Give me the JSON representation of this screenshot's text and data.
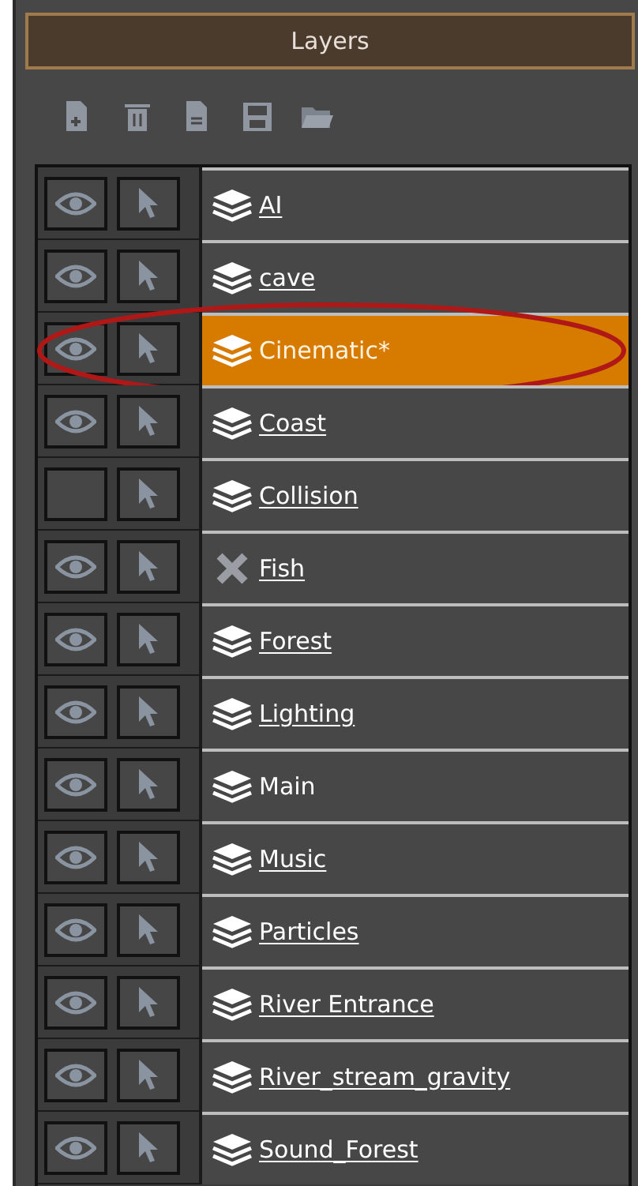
{
  "panel": {
    "title": "Layers"
  },
  "layers": [
    {
      "name": "AI",
      "kind": "layer",
      "visible": true,
      "underlined": true,
      "selected": false
    },
    {
      "name": "cave",
      "kind": "layer",
      "visible": true,
      "underlined": true,
      "selected": false
    },
    {
      "name": "Cinematic*",
      "kind": "layer",
      "visible": true,
      "underlined": false,
      "selected": true
    },
    {
      "name": "Coast",
      "kind": "layer",
      "visible": true,
      "underlined": true,
      "selected": false
    },
    {
      "name": "Collision",
      "kind": "layer",
      "visible": false,
      "underlined": true,
      "selected": false
    },
    {
      "name": "Fish",
      "kind": "excluded",
      "visible": true,
      "underlined": true,
      "selected": false
    },
    {
      "name": "Forest",
      "kind": "layer",
      "visible": true,
      "underlined": true,
      "selected": false
    },
    {
      "name": "Lighting",
      "kind": "layer",
      "visible": true,
      "underlined": true,
      "selected": false
    },
    {
      "name": "Main",
      "kind": "layer",
      "visible": true,
      "underlined": false,
      "selected": false
    },
    {
      "name": "Music",
      "kind": "layer",
      "visible": true,
      "underlined": true,
      "selected": false
    },
    {
      "name": "Particles",
      "kind": "layer",
      "visible": true,
      "underlined": true,
      "selected": false
    },
    {
      "name": "River Entrance",
      "kind": "layer",
      "visible": true,
      "underlined": true,
      "selected": false
    },
    {
      "name": "River_stream_gravity",
      "kind": "layer",
      "visible": true,
      "underlined": true,
      "selected": false
    },
    {
      "name": "Sound_Forest",
      "kind": "layer",
      "visible": true,
      "underlined": true,
      "selected": false
    }
  ]
}
